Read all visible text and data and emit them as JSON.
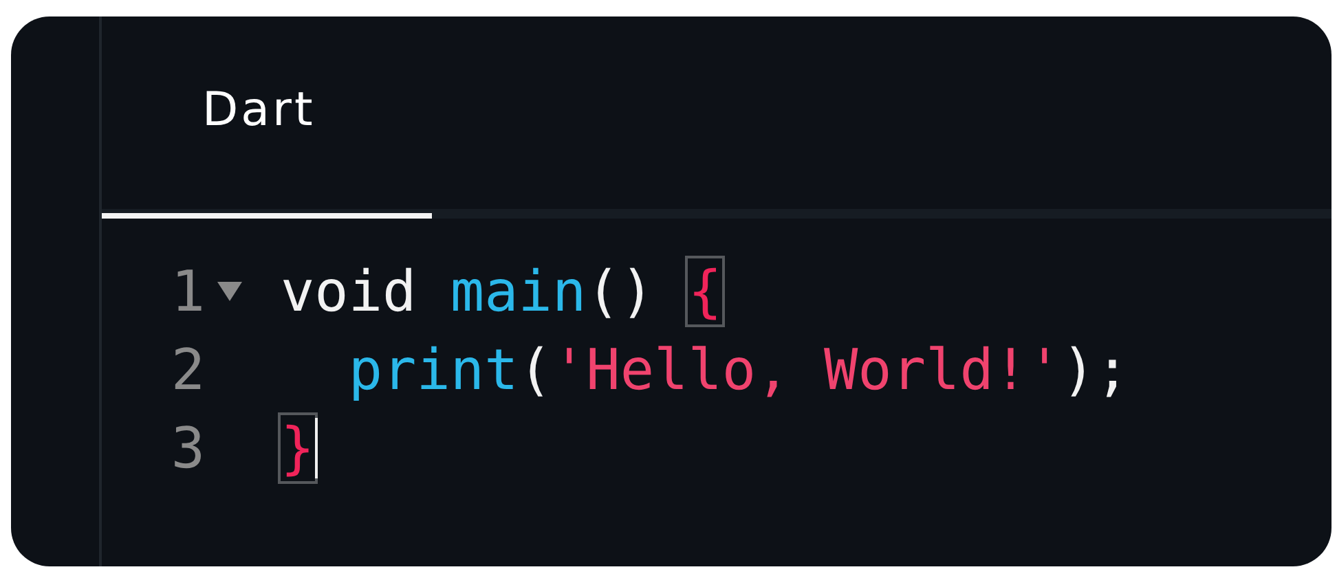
{
  "tabs": [
    {
      "label": "Dart",
      "selected": true
    }
  ],
  "editor": {
    "lines": [
      {
        "number": "1",
        "fold": {
          "expanded": true
        },
        "tokens": [
          {
            "text": "void ",
            "kind": "keyword"
          },
          {
            "text": "main",
            "kind": "function"
          },
          {
            "text": "() ",
            "kind": "plain"
          },
          {
            "text": "{",
            "kind": "bracket",
            "matched": true
          }
        ]
      },
      {
        "number": "2",
        "tokens": [
          {
            "text": "  print",
            "kind": "function"
          },
          {
            "text": "(",
            "kind": "plain"
          },
          {
            "text": "'Hello, World!'",
            "kind": "string"
          },
          {
            "text": ");",
            "kind": "plain"
          }
        ]
      },
      {
        "number": "3",
        "cursor": true,
        "tokens": [
          {
            "text": "}",
            "kind": "bracket",
            "matched": true
          }
        ]
      }
    ]
  }
}
